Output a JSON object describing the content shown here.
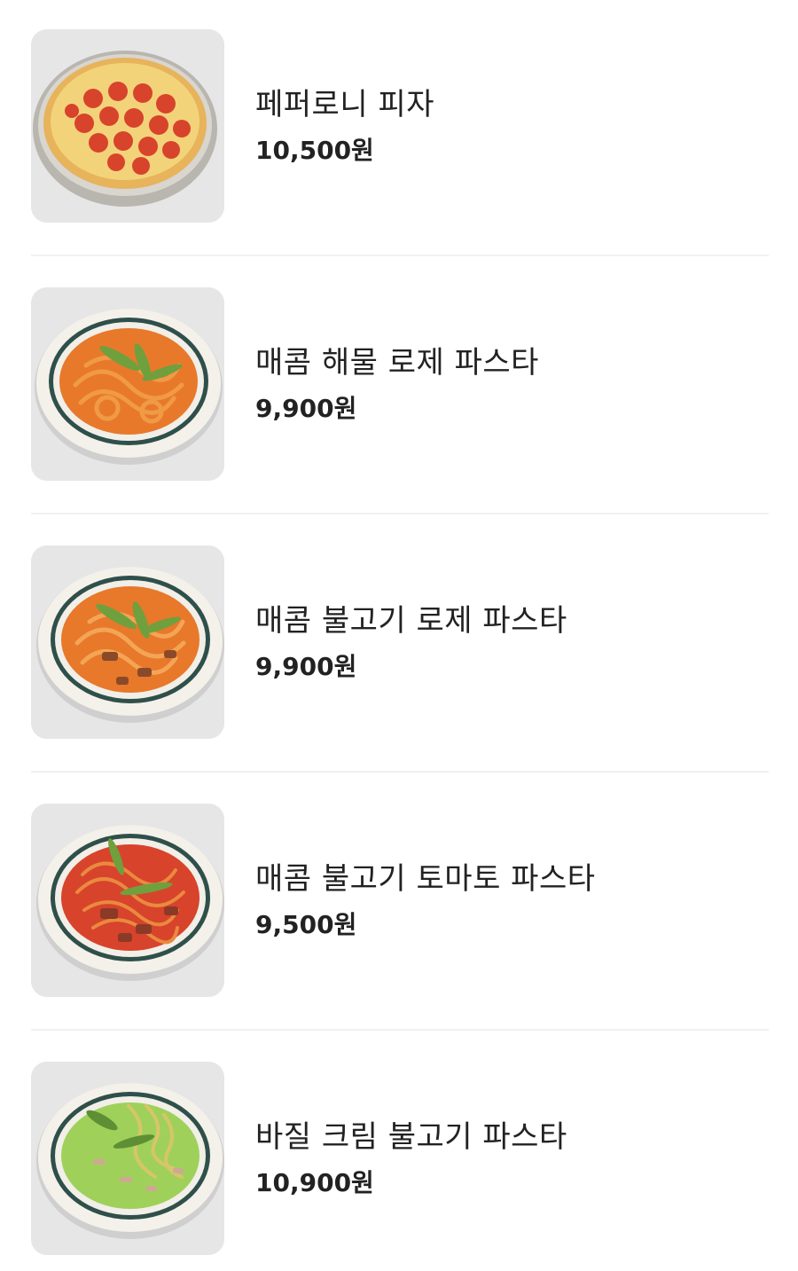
{
  "menu": {
    "items": [
      {
        "name": "페퍼로니 피자",
        "price": "10,500원",
        "icon": "pepperoni-pizza-photo",
        "sauce_color": "#e4572e",
        "top_color": "#f2c45c"
      },
      {
        "name": "매콤 해물 로제 파스타",
        "price": "9,900원",
        "icon": "seafood-rose-pasta-photo",
        "sauce_color": "#e8792b",
        "top_color": "#f0943d"
      },
      {
        "name": "매콤 불고기 로제 파스타",
        "price": "9,900원",
        "icon": "bulgogi-rose-pasta-photo",
        "sauce_color": "#e8782a",
        "top_color": "#f09a46"
      },
      {
        "name": "매콤 불고기 토마토 파스타",
        "price": "9,500원",
        "icon": "bulgogi-tomato-pasta-photo",
        "sauce_color": "#d8432c",
        "top_color": "#e5793a"
      },
      {
        "name": "바질 크림 불고기 파스타",
        "price": "10,900원",
        "icon": "basil-cream-pasta-photo",
        "sauce_color": "#9fd15a",
        "top_color": "#d8c46a"
      }
    ]
  }
}
